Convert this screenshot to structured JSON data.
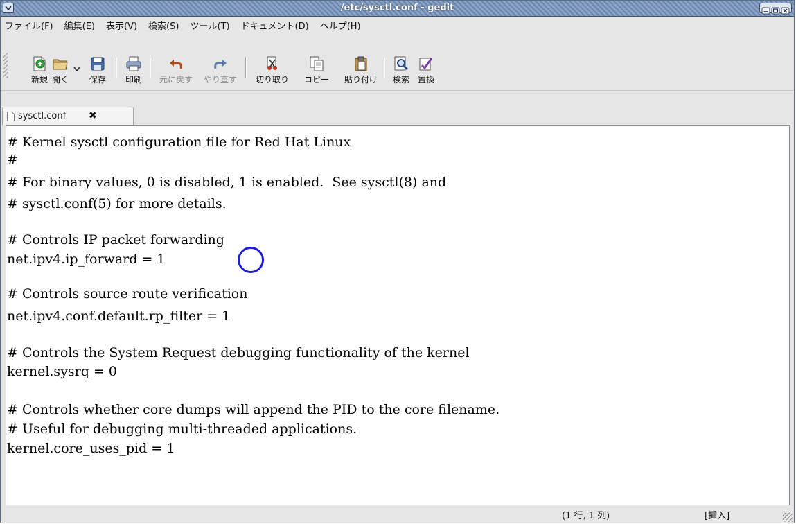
{
  "window": {
    "title": "/etc/sysctl.conf - gedit"
  },
  "menubar": {
    "items": [
      "ファイル(F)",
      "編集(E)",
      "表示(V)",
      "検索(S)",
      "ツール(T)",
      "ドキュメント(D)",
      "ヘルプ(H)"
    ]
  },
  "toolbar": {
    "new_label": "新規",
    "open_label": "開く",
    "save_label": "保存",
    "print_label": "印刷",
    "undo_label": "元に戻す",
    "redo_label": "やり直す",
    "cut_label": "切り取り",
    "copy_label": "コピー",
    "paste_label": "貼り付け",
    "find_label": "検索",
    "replace_label": "置換"
  },
  "tab": {
    "name": "sysctl.conf",
    "close_glyph": "✖"
  },
  "editor": {
    "lines": [
      "# Kernel sysctl configuration file for Red Hat Linux",
      "#",
      "# For binary values, 0 is disabled, 1 is enabled.  See sysctl(8) and",
      "# sysctl.conf(5) for more details.",
      "",
      "# Controls IP packet forwarding",
      "net.ipv4.ip_forward = 1",
      "",
      "# Controls source route verification",
      "net.ipv4.conf.default.rp_filter = 1",
      "",
      "# Controls the System Request debugging functionality of the kernel",
      "kernel.sysrq = 0",
      "",
      "# Controls whether core dumps will append the PID to the core filename.",
      "# Useful for debugging multi-threaded applications.",
      "kernel.core_uses_pid = 1"
    ],
    "highlight_color": "#1d1de0"
  },
  "statusbar": {
    "position": "(1 行, 1 列)",
    "mode": "[挿入]"
  }
}
